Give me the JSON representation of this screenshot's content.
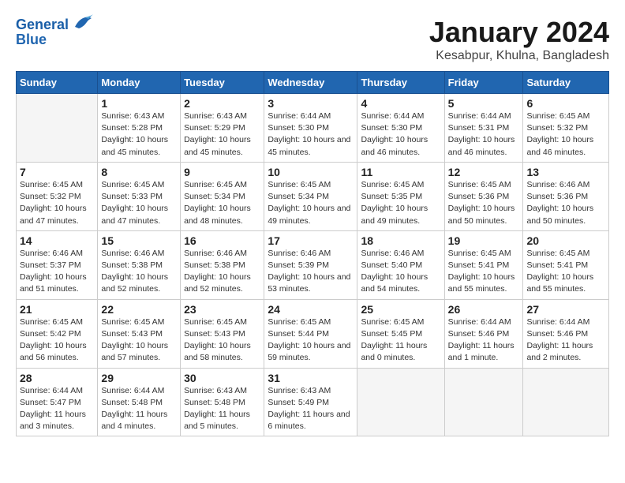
{
  "logo": {
    "line1": "General",
    "line2": "Blue"
  },
  "title": "January 2024",
  "subtitle": "Kesabpur, Khulna, Bangladesh",
  "days_header": [
    "Sunday",
    "Monday",
    "Tuesday",
    "Wednesday",
    "Thursday",
    "Friday",
    "Saturday"
  ],
  "weeks": [
    [
      {
        "day": "",
        "sunrise": "",
        "sunset": "",
        "daylight": ""
      },
      {
        "day": "1",
        "sunrise": "Sunrise: 6:43 AM",
        "sunset": "Sunset: 5:28 PM",
        "daylight": "Daylight: 10 hours and 45 minutes."
      },
      {
        "day": "2",
        "sunrise": "Sunrise: 6:43 AM",
        "sunset": "Sunset: 5:29 PM",
        "daylight": "Daylight: 10 hours and 45 minutes."
      },
      {
        "day": "3",
        "sunrise": "Sunrise: 6:44 AM",
        "sunset": "Sunset: 5:30 PM",
        "daylight": "Daylight: 10 hours and 45 minutes."
      },
      {
        "day": "4",
        "sunrise": "Sunrise: 6:44 AM",
        "sunset": "Sunset: 5:30 PM",
        "daylight": "Daylight: 10 hours and 46 minutes."
      },
      {
        "day": "5",
        "sunrise": "Sunrise: 6:44 AM",
        "sunset": "Sunset: 5:31 PM",
        "daylight": "Daylight: 10 hours and 46 minutes."
      },
      {
        "day": "6",
        "sunrise": "Sunrise: 6:45 AM",
        "sunset": "Sunset: 5:32 PM",
        "daylight": "Daylight: 10 hours and 46 minutes."
      }
    ],
    [
      {
        "day": "7",
        "sunrise": "Sunrise: 6:45 AM",
        "sunset": "Sunset: 5:32 PM",
        "daylight": "Daylight: 10 hours and 47 minutes."
      },
      {
        "day": "8",
        "sunrise": "Sunrise: 6:45 AM",
        "sunset": "Sunset: 5:33 PM",
        "daylight": "Daylight: 10 hours and 47 minutes."
      },
      {
        "day": "9",
        "sunrise": "Sunrise: 6:45 AM",
        "sunset": "Sunset: 5:34 PM",
        "daylight": "Daylight: 10 hours and 48 minutes."
      },
      {
        "day": "10",
        "sunrise": "Sunrise: 6:45 AM",
        "sunset": "Sunset: 5:34 PM",
        "daylight": "Daylight: 10 hours and 49 minutes."
      },
      {
        "day": "11",
        "sunrise": "Sunrise: 6:45 AM",
        "sunset": "Sunset: 5:35 PM",
        "daylight": "Daylight: 10 hours and 49 minutes."
      },
      {
        "day": "12",
        "sunrise": "Sunrise: 6:45 AM",
        "sunset": "Sunset: 5:36 PM",
        "daylight": "Daylight: 10 hours and 50 minutes."
      },
      {
        "day": "13",
        "sunrise": "Sunrise: 6:46 AM",
        "sunset": "Sunset: 5:36 PM",
        "daylight": "Daylight: 10 hours and 50 minutes."
      }
    ],
    [
      {
        "day": "14",
        "sunrise": "Sunrise: 6:46 AM",
        "sunset": "Sunset: 5:37 PM",
        "daylight": "Daylight: 10 hours and 51 minutes."
      },
      {
        "day": "15",
        "sunrise": "Sunrise: 6:46 AM",
        "sunset": "Sunset: 5:38 PM",
        "daylight": "Daylight: 10 hours and 52 minutes."
      },
      {
        "day": "16",
        "sunrise": "Sunrise: 6:46 AM",
        "sunset": "Sunset: 5:38 PM",
        "daylight": "Daylight: 10 hours and 52 minutes."
      },
      {
        "day": "17",
        "sunrise": "Sunrise: 6:46 AM",
        "sunset": "Sunset: 5:39 PM",
        "daylight": "Daylight: 10 hours and 53 minutes."
      },
      {
        "day": "18",
        "sunrise": "Sunrise: 6:46 AM",
        "sunset": "Sunset: 5:40 PM",
        "daylight": "Daylight: 10 hours and 54 minutes."
      },
      {
        "day": "19",
        "sunrise": "Sunrise: 6:45 AM",
        "sunset": "Sunset: 5:41 PM",
        "daylight": "Daylight: 10 hours and 55 minutes."
      },
      {
        "day": "20",
        "sunrise": "Sunrise: 6:45 AM",
        "sunset": "Sunset: 5:41 PM",
        "daylight": "Daylight: 10 hours and 55 minutes."
      }
    ],
    [
      {
        "day": "21",
        "sunrise": "Sunrise: 6:45 AM",
        "sunset": "Sunset: 5:42 PM",
        "daylight": "Daylight: 10 hours and 56 minutes."
      },
      {
        "day": "22",
        "sunrise": "Sunrise: 6:45 AM",
        "sunset": "Sunset: 5:43 PM",
        "daylight": "Daylight: 10 hours and 57 minutes."
      },
      {
        "day": "23",
        "sunrise": "Sunrise: 6:45 AM",
        "sunset": "Sunset: 5:43 PM",
        "daylight": "Daylight: 10 hours and 58 minutes."
      },
      {
        "day": "24",
        "sunrise": "Sunrise: 6:45 AM",
        "sunset": "Sunset: 5:44 PM",
        "daylight": "Daylight: 10 hours and 59 minutes."
      },
      {
        "day": "25",
        "sunrise": "Sunrise: 6:45 AM",
        "sunset": "Sunset: 5:45 PM",
        "daylight": "Daylight: 11 hours and 0 minutes."
      },
      {
        "day": "26",
        "sunrise": "Sunrise: 6:44 AM",
        "sunset": "Sunset: 5:46 PM",
        "daylight": "Daylight: 11 hours and 1 minute."
      },
      {
        "day": "27",
        "sunrise": "Sunrise: 6:44 AM",
        "sunset": "Sunset: 5:46 PM",
        "daylight": "Daylight: 11 hours and 2 minutes."
      }
    ],
    [
      {
        "day": "28",
        "sunrise": "Sunrise: 6:44 AM",
        "sunset": "Sunset: 5:47 PM",
        "daylight": "Daylight: 11 hours and 3 minutes."
      },
      {
        "day": "29",
        "sunrise": "Sunrise: 6:44 AM",
        "sunset": "Sunset: 5:48 PM",
        "daylight": "Daylight: 11 hours and 4 minutes."
      },
      {
        "day": "30",
        "sunrise": "Sunrise: 6:43 AM",
        "sunset": "Sunset: 5:48 PM",
        "daylight": "Daylight: 11 hours and 5 minutes."
      },
      {
        "day": "31",
        "sunrise": "Sunrise: 6:43 AM",
        "sunset": "Sunset: 5:49 PM",
        "daylight": "Daylight: 11 hours and 6 minutes."
      },
      {
        "day": "",
        "sunrise": "",
        "sunset": "",
        "daylight": ""
      },
      {
        "day": "",
        "sunrise": "",
        "sunset": "",
        "daylight": ""
      },
      {
        "day": "",
        "sunrise": "",
        "sunset": "",
        "daylight": ""
      }
    ]
  ]
}
